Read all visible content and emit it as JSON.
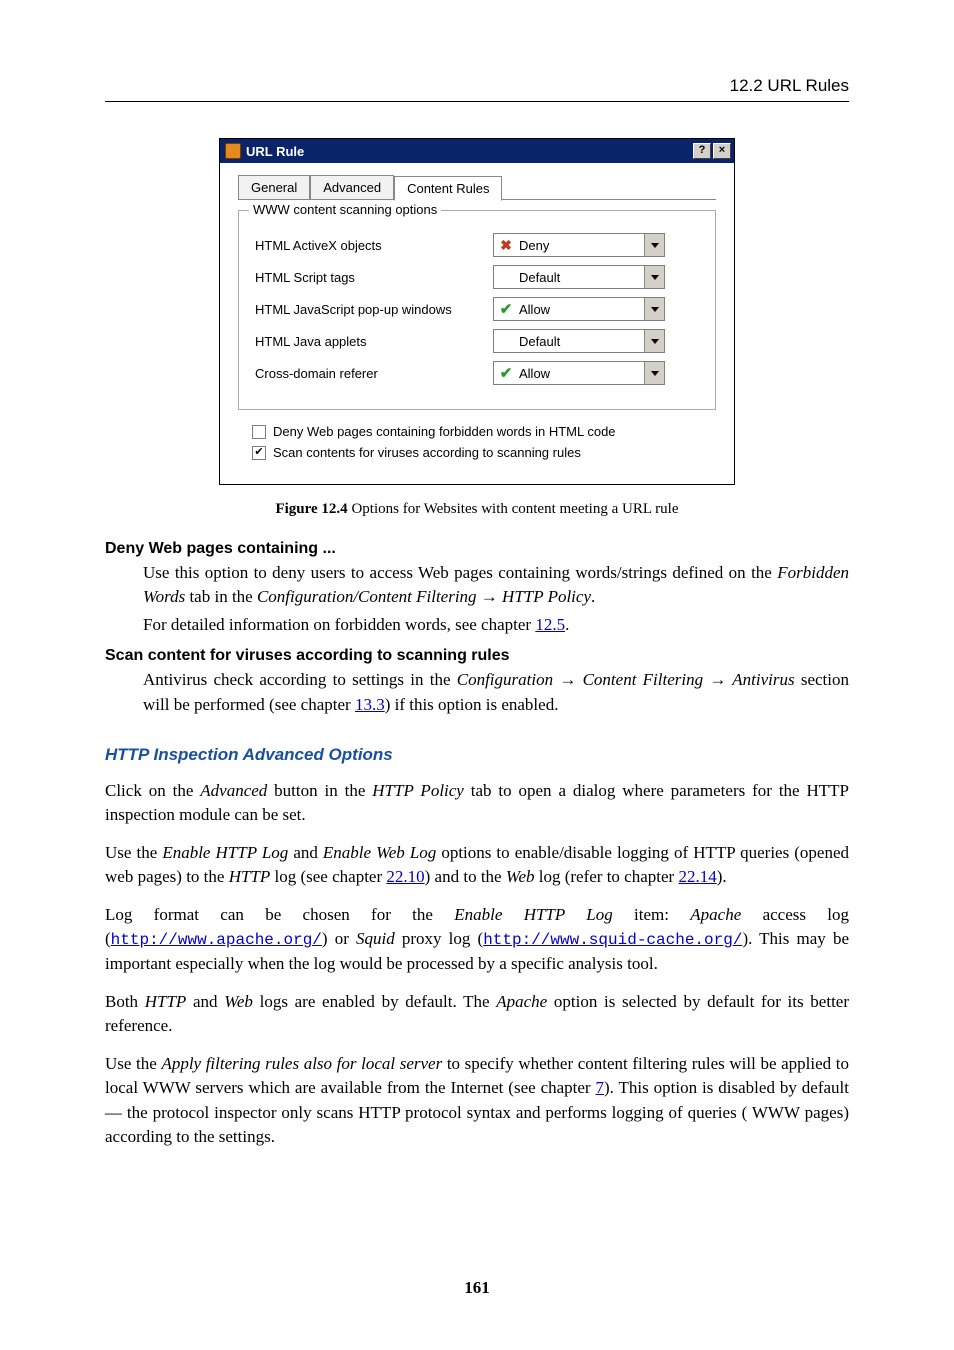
{
  "header": {
    "section": "12.2  URL Rules"
  },
  "dialog": {
    "title": "URL Rule",
    "help_glyph": "?",
    "close_glyph": "×",
    "tabs": {
      "general": "General",
      "advanced": "Advanced",
      "content": "Content Rules"
    },
    "fieldset_legend": "WWW content scanning options",
    "rows": {
      "activex": {
        "label": "HTML ActiveX objects",
        "value": "Deny"
      },
      "script": {
        "label": "HTML Script tags",
        "value": "Default"
      },
      "popup": {
        "label": "HTML JavaScript pop-up windows",
        "value": "Allow"
      },
      "java": {
        "label": "HTML Java applets",
        "value": "Default"
      },
      "referer": {
        "label": "Cross-domain referer",
        "value": "Allow"
      }
    },
    "check_deny": "Deny Web pages containing forbidden words in HTML code",
    "check_scan": "Scan contents for viruses according to scanning rules"
  },
  "caption": {
    "label": "Figure 12.4",
    "text": "   Options for Websites with content meeting a URL rule"
  },
  "terms": {
    "deny": {
      "heading": "Deny Web pages containing ...",
      "p1a": "Use this option to deny users to access Web pages containing words/strings defined on the ",
      "p1b": "Forbidden Words",
      "p1c": " tab in the ",
      "p1d": "Configuration/Content Filtering → HTTP Policy",
      "p1e": ".",
      "p2a": "For detailed information on forbidden words, see chapter ",
      "p2b": "12.5",
      "p2c": "."
    },
    "scan": {
      "heading": "Scan content for viruses according to scanning rules",
      "p1a": "Antivirus check according to settings in the ",
      "p1b": "Configuration → Content Filtering → Antivirus",
      "p1c": " section will be performed (see chapter ",
      "p1d": "13.3",
      "p1e": ") if this option is enabled."
    }
  },
  "section_head": "HTTP Inspection Advanced Options",
  "body": {
    "p1a": "Click on the ",
    "p1b": "Advanced",
    "p1c": " button in the ",
    "p1d": "HTTP Policy",
    "p1e": " tab to open a dialog where parameters for the HTTP inspection module can be set.",
    "p2a": "Use the ",
    "p2b": "Enable HTTP Log",
    "p2c": " and ",
    "p2d": "Enable Web Log",
    "p2e": " options to enable/disable logging of HTTP queries (opened web pages) to the ",
    "p2f": "HTTP",
    "p2g": " log (see chapter ",
    "p2h": "22.10",
    "p2i": ") and to the ",
    "p2j": "Web",
    "p2k": " log (refer to chapter ",
    "p2l": "22.14",
    "p2m": ").",
    "p3a": "Log  format  can  be  chosen  for  the  ",
    "p3b": "Enable  HTTP  Log",
    "p3c": "  item:    ",
    "p3d": "Apache",
    "p3e": "  access  log (",
    "p3f": "http://www.apache.org/",
    "p3g": ") or ",
    "p3h": "Squid",
    "p3i": " proxy log (",
    "p3j": "http://www.squid-cache.org/",
    "p3k": "). This may be important especially when the log would be processed by a specific analysis tool.",
    "p4a": "Both ",
    "p4b": "HTTP",
    "p4c": " and ",
    "p4d": "Web",
    "p4e": " logs are enabled by default. The ",
    "p4f": "Apache",
    "p4g": " option is selected by default for its better reference.",
    "p5a": "Use the ",
    "p5b": "Apply filtering rules also for local server",
    "p5c": " to specify whether content filtering rules will be applied to local WWW servers which are available from the Internet (see chapter ",
    "p5d": "7",
    "p5e": "). This option is disabled by default — the protocol inspector only scans HTTP protocol syntax and performs logging of queries ( WWW pages) according to the settings."
  },
  "pagenum": "161"
}
